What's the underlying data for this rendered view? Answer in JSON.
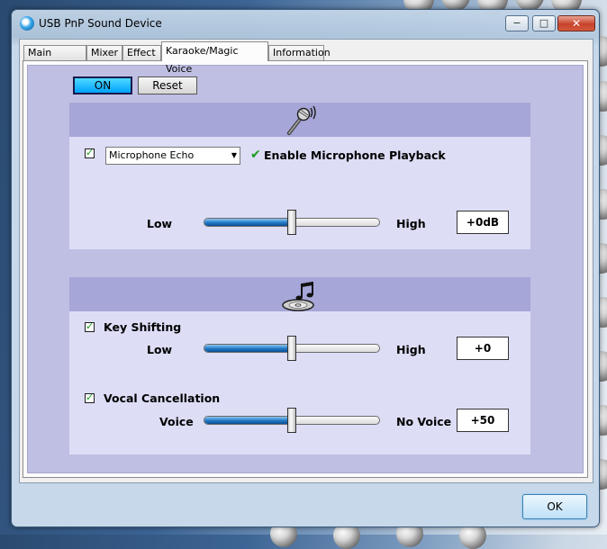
{
  "window": {
    "title": "USB PnP Sound Device",
    "minimize": "−",
    "maximize": "□",
    "close": "✕"
  },
  "tabs": [
    {
      "label": "Main Setting",
      "active": false
    },
    {
      "label": "Mixer",
      "active": false
    },
    {
      "label": "Effect",
      "active": false
    },
    {
      "label": "Karaoke/Magic Voice",
      "active": true
    },
    {
      "label": "Information",
      "active": false
    }
  ],
  "controls": {
    "on_label": "ON",
    "reset_label": "Reset"
  },
  "microphone_panel": {
    "icon": "microphone-icon",
    "echo_checked": true,
    "select_value": "Microphone Echo",
    "playback_checkmark": "✔",
    "playback_label": "Enable Microphone Playback",
    "slider": {
      "left_label": "Low",
      "right_label": "High",
      "value": "+0dB",
      "position": 0.5
    }
  },
  "music_panel": {
    "icon": "music-cd-icon",
    "key_shifting": {
      "checked": true,
      "label": "Key Shifting",
      "left_label": "Low",
      "right_label": "High",
      "value": "+0",
      "position": 0.5
    },
    "vocal_cancellation": {
      "checked": true,
      "label": "Vocal Cancellation",
      "left_label": "Voice",
      "right_label": "No Voice",
      "value": "+50",
      "position": 0.5
    }
  },
  "footer": {
    "ok_label": "OK"
  },
  "colors": {
    "panel_bg": "#bfbfe3",
    "panel_head": "#a6a6d8",
    "on_button": "#00a2ff"
  }
}
